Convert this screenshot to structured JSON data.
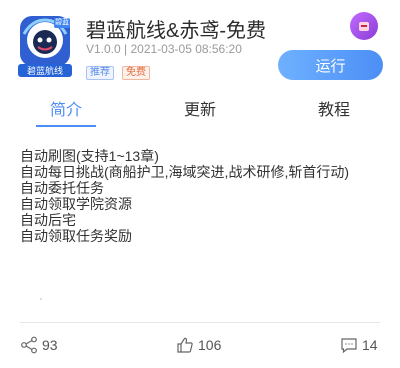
{
  "app": {
    "title": "碧蓝航线&赤鸢-免费",
    "meta": "V1.0.0 | 2021-03-05 08:56:20",
    "tags": [
      "推荐",
      "免费"
    ],
    "icon_label": "碧蓝航线",
    "icon_badge": "碧蓝",
    "run_label": "运行"
  },
  "tabs": [
    {
      "label": "简介",
      "active": true
    },
    {
      "label": "更新",
      "active": false
    },
    {
      "label": "教程",
      "active": false
    }
  ],
  "description": [
    "自动刷图(支持1~13章)",
    "自动每日挑战(商船护卫,海域突进,战术研修,斩首行动)",
    "自动委托任务",
    "自动领取学院资源",
    "自动后宅",
    "自动领取任务奖励"
  ],
  "stats": {
    "share": "93",
    "like": "106",
    "comment": "14"
  },
  "colors": {
    "accent": "#4c8ef5",
    "tag_recommend": "#5b8de8",
    "tag_free": "#e26a3c",
    "avatar": "#a455e8"
  }
}
